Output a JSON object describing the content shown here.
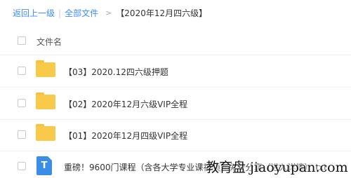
{
  "breadcrumb": {
    "back": "返回上一级",
    "separator": "|",
    "all_files": "全部文件",
    "arrow": ">",
    "current": "【2020年12月四六级】"
  },
  "list_header": {
    "label": "文件名"
  },
  "files": [
    {
      "name": "【03】2020.12四六级押题",
      "icon": "folder-icon"
    },
    {
      "name": "【02】2020年12月六级VIP全程",
      "icon": "folder-icon"
    },
    {
      "name": "【01】2020年12月四级VIP全程",
      "icon": "folder-icon"
    },
    {
      "name": "重磅！9600门课程（含各大学专业课视频）免费分享（进入详情）.txt",
      "icon": "text-file-icon",
      "icon_letter": "T"
    }
  ],
  "watermark": "教育盘 jiaoyupan.com",
  "colors": {
    "link": "#3b8cff",
    "folder": "#f9c94a",
    "txt_icon": "#3a8ee6"
  }
}
